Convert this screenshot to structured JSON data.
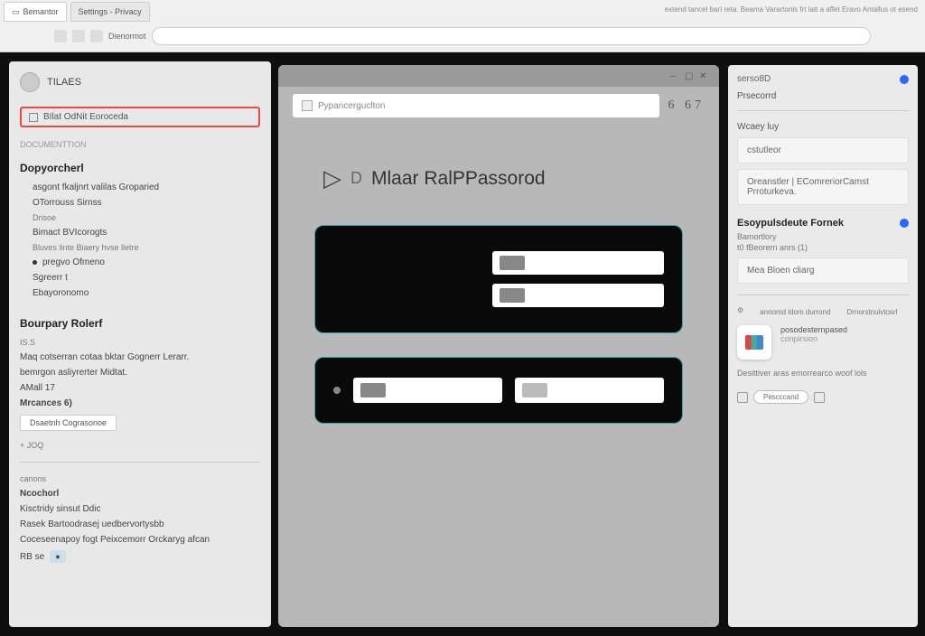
{
  "chrome": {
    "tabs": [
      {
        "label": "Bemantor"
      },
      {
        "label": "Settings - Privacy"
      }
    ],
    "addr_hint_right": "extend tancel barI reta. Beama Varartonls frt latt a affet Eravo Antallus ot esend",
    "addr_bar": "",
    "tool_label": "Dienormot"
  },
  "left": {
    "user": "TILAES",
    "highlight": "BIlat OdNit Eoroceda",
    "sub": "DOCUMENTTION",
    "sections": {
      "defaults": {
        "title": "Dopyorcherl",
        "items": [
          "asgont fkaljnrt valilas Groparied",
          "OTorrouss Sirnss",
          "Drisoe",
          "Bimact BVIcorogts",
          "Bluves linte Biaery hvse lletre",
          "pregvo Ofmeno",
          "Sgreerr t",
          "Ebayoronomo"
        ]
      },
      "recent": {
        "title": "Bourpary Rolerf",
        "tag": "IS.S",
        "lines": [
          "Maq cotserran cotaa bktar Gognerr Lerarr.",
          "bemrgon asliyrerter Midtat.",
          "AMall 17",
          "Mrcances 6)",
          "Dsaetnh Cograsonoe",
          "+ JOQ"
        ]
      },
      "notes": {
        "label": "canons",
        "title": "Ncochorl",
        "lines": [
          "Kisctridy sinsut Ddic",
          "Rasek Bartoodrasej uedbervortysbb",
          "Coceseenapoy fogt Peixcemorr Orckaryg afcan",
          "RB se"
        ]
      }
    }
  },
  "modal": {
    "addr": "Pypancerguclton",
    "code": "6 67",
    "heading": "Mlaar RalPPassorod",
    "field1": "",
    "field2": "",
    "field3": "",
    "field4": ""
  },
  "right": {
    "header": "serso8D",
    "line1": "Prsecorrd",
    "sec1": "Wcaey luy",
    "card1": "cstutleor",
    "card2_a": "Oreanstler | EComreriorCamst",
    "card2_b": "Prroturkeva.",
    "bold": "Esoypulsdeute Fornek",
    "bold_sub1": "Bamortlory",
    "bold_sub2": "t0 fBeorern anrs (1)",
    "card3": "Mea Bloen cliarg",
    "tabs": [
      "annomd ldom durrond",
      "Drnorstnulvtosrl"
    ],
    "app_name": "posodesternpased",
    "app_sub": "conpirsion",
    "foot_line": "Desittiver aras emorrearco woof lols",
    "foot_btn": "Pescccand"
  }
}
